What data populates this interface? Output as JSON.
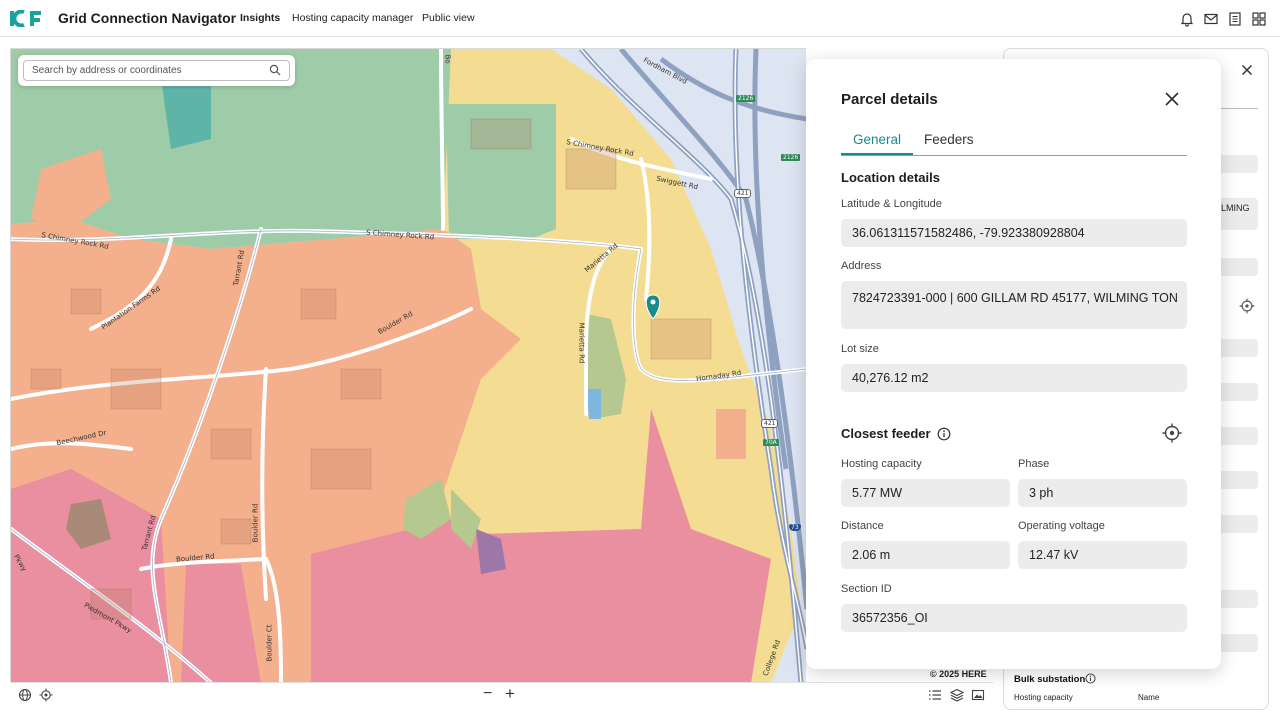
{
  "app": {
    "title": "Grid Connection Navigator",
    "logo_text": "ICF",
    "nav": [
      {
        "label": "Insights",
        "active": true
      },
      {
        "label": "Hosting capacity manager",
        "active": false
      },
      {
        "label": "Public view",
        "active": false
      }
    ],
    "header_icons": [
      "bell-icon",
      "mail-icon",
      "document-icon",
      "apps-grid-icon"
    ]
  },
  "search": {
    "placeholder": "Search by address or coordinates"
  },
  "map": {
    "attribution": "© 2025 HERE",
    "roads": [
      "Fordham Blvd",
      "S Chimney Rock Rd",
      "S Chimney Rock Rd",
      "Swiggett Rd",
      "Marietta Rd",
      "Marietta Rd",
      "Plantation Farms Rd",
      "Tarrant Rd",
      "Boulder Rd",
      "Beechwood Dr",
      "Tarrant Rd",
      "Boulder Rd",
      "Boulder Rd",
      "Piedmont Pkwy",
      "Boulder Ct",
      "Hornaday Rd",
      "College Rd",
      "Bo",
      "S Chimney Rock Rd",
      "Pkwy"
    ],
    "shields": [
      "2126",
      "2126",
      "421",
      "421",
      "70A",
      "73"
    ]
  },
  "bottom_toolbar": {
    "left_icons": [
      "globe-icon",
      "locate-icon"
    ],
    "zoom_out": "−",
    "zoom_in": "+",
    "right_icons": [
      "list-icon",
      "layers-icon",
      "image-icon"
    ]
  },
  "side_panel": {
    "partial_text": "LMING",
    "bulk_substation_label": "Bulk substation",
    "col_hosting": "Hosting capacity",
    "col_name": "Name"
  },
  "parcel": {
    "title": "Parcel details",
    "tabs": [
      {
        "label": "General",
        "active": true
      },
      {
        "label": "Feeders",
        "active": false
      }
    ],
    "location": {
      "heading": "Location details",
      "latlon_label": "Latitude & Longitude",
      "latlon_value": "36.061311571582486, -79.923380928804",
      "address_label": "Address",
      "address_value": "7824723391-000 | 600 GILLAM RD 45177, WILMING TON",
      "lot_label": "Lot size",
      "lot_value": "40,276.12 m2"
    },
    "feeder": {
      "heading": "Closest feeder",
      "hosting_label": "Hosting capacity",
      "hosting_value": "5.77 MW",
      "phase_label": "Phase",
      "phase_value": "3 ph",
      "distance_label": "Distance",
      "distance_value": "2.06 m",
      "voltage_label": "Operating voltage",
      "voltage_value": "12.47 kV",
      "section_label": "Section ID",
      "section_value": "36572356_OI"
    }
  },
  "colors": {
    "accent": "#1a8a8a",
    "zone_green": "#9ecba8",
    "zone_orange": "#f4b08c",
    "zone_yellow": "#f4dd92",
    "zone_pink": "#e98f9f",
    "water": "#cfdcef"
  }
}
